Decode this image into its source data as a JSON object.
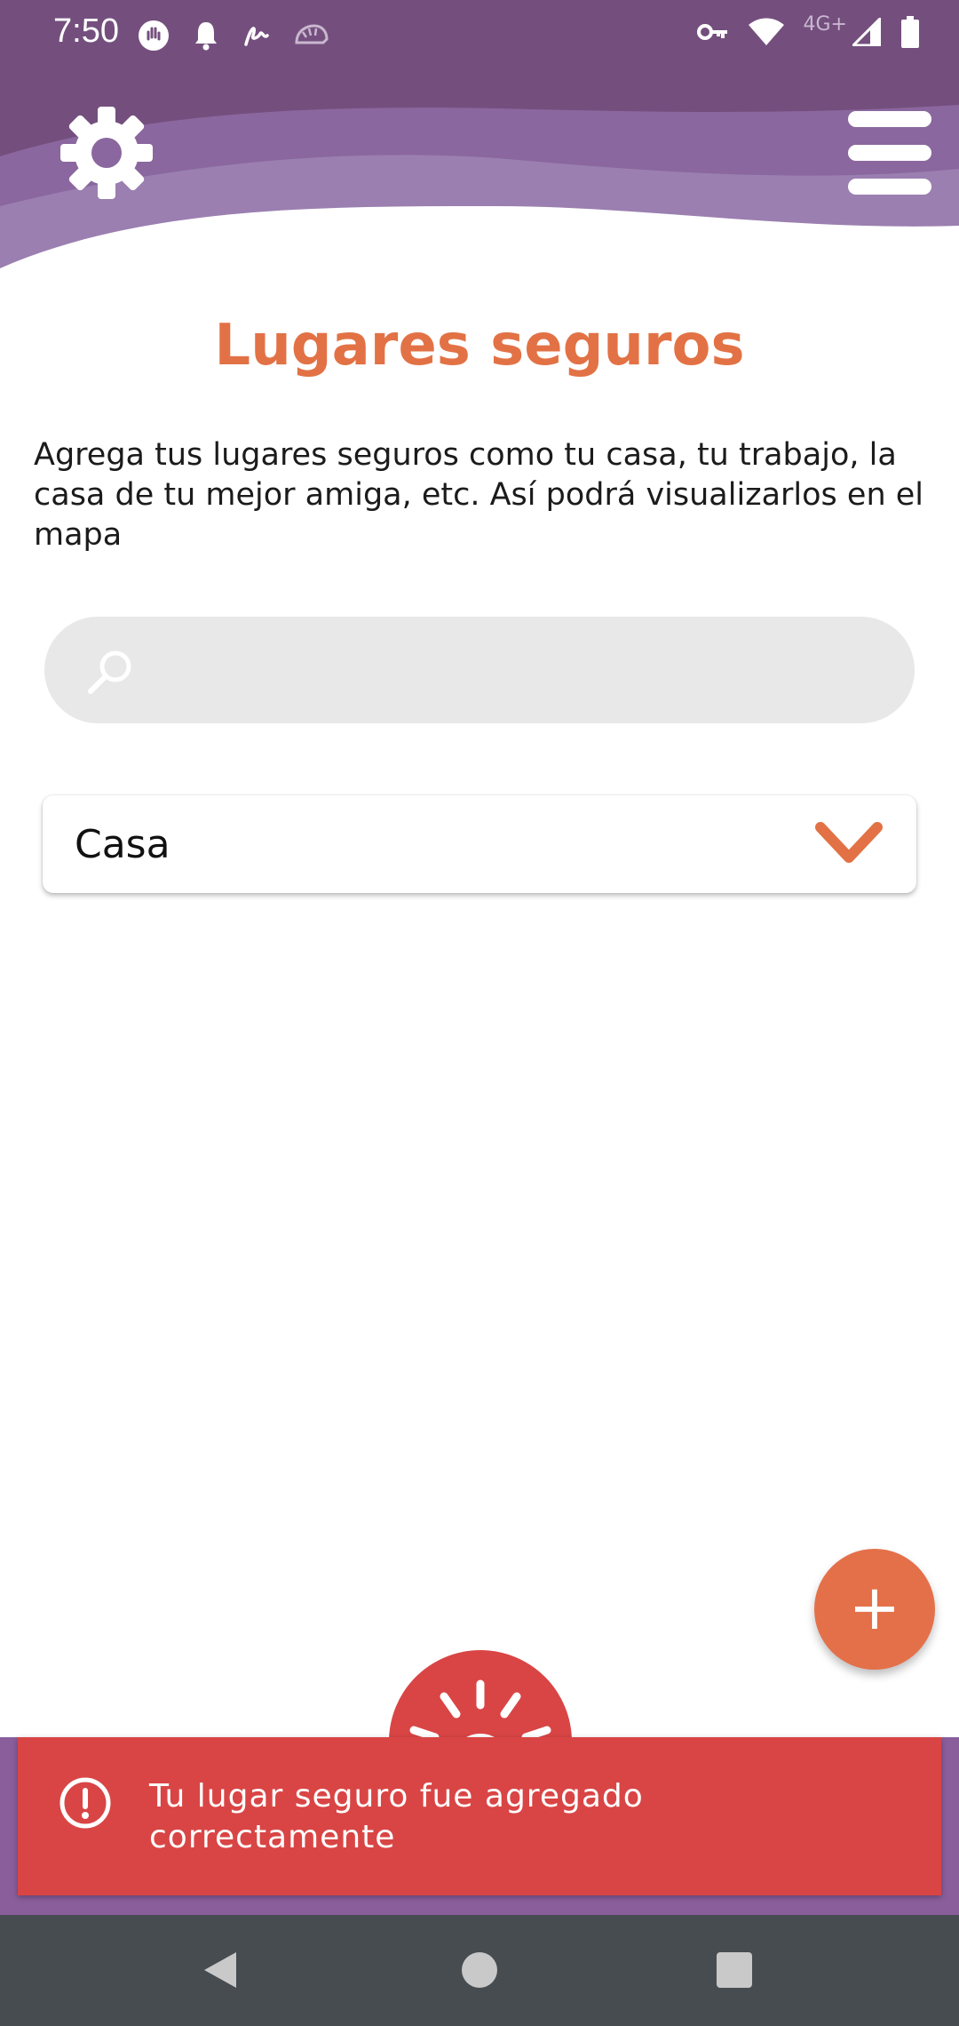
{
  "status_bar": {
    "time": "7:50",
    "network_label": "4G+",
    "left_icons": [
      "hand-icon",
      "bell-icon",
      "signature-icon",
      "hedgehog-icon"
    ],
    "right_icons": [
      "key-icon",
      "wifi-icon",
      "signal-icon",
      "battery-icon"
    ]
  },
  "header": {
    "settings_icon": "gear-icon",
    "menu_icon": "hamburger-menu-icon",
    "wave_colors": [
      "#744f7e",
      "#8a679e",
      "#9b7fb0"
    ]
  },
  "page": {
    "title": "Lugares seguros",
    "description": "Agrega tus lugares seguros como tu casa, tu trabajo, la casa de tu mejor amiga, etc. Así podrá visualizarlos en el mapa"
  },
  "search": {
    "value": "",
    "placeholder": "",
    "icon": "search-icon"
  },
  "place_select": {
    "selected": "Casa",
    "icon": "chevron-down-icon"
  },
  "fab": {
    "label": "+"
  },
  "snackbar": {
    "message": "Tu lugar seguro fue agregado correctamente",
    "icon": "alert-circle-icon"
  },
  "colors": {
    "accent_orange": "#e27245",
    "header_purple": "#744f7e",
    "snackbar_red": "#d94545",
    "nav_bar": "#474c51"
  }
}
